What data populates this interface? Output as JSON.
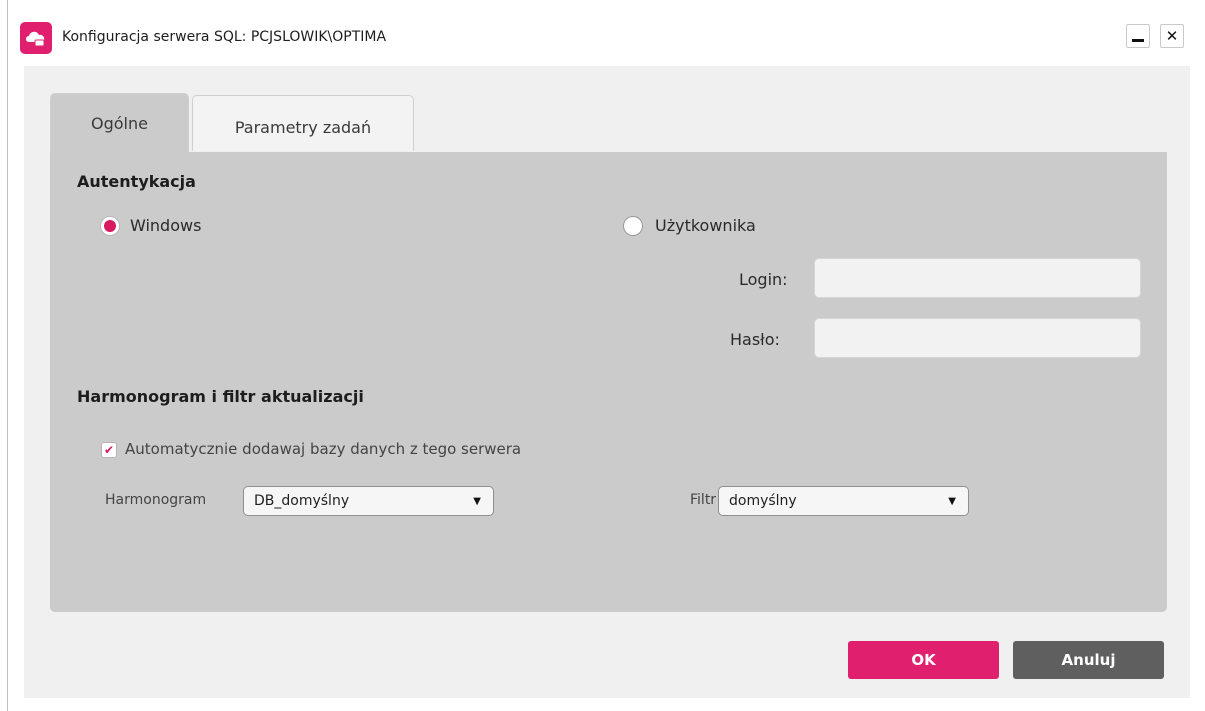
{
  "window": {
    "title": "Konfiguracja serwera SQL: PCJSLOWIK\\OPTIMA"
  },
  "tabs": [
    {
      "label": "Ogólne",
      "active": true
    },
    {
      "label": "Parametry zadań",
      "active": false
    }
  ],
  "auth": {
    "section_title": "Autentykacja",
    "windows_label": "Windows",
    "user_label": "Użytkownika",
    "selected": "Windows",
    "login_label": "Login:",
    "login_value": "",
    "password_label": "Hasło:",
    "password_value": ""
  },
  "schedule": {
    "section_title": "Harmonogram i filtr aktualizacji",
    "auto_add_label": "Automatycznie dodawaj bazy danych z tego serwera",
    "auto_add_checked": true,
    "harmonogram_label": "Harmonogram",
    "harmonogram_value": "DB_domyślny",
    "filter_label": "Filtr",
    "filter_value": "domyślny"
  },
  "buttons": {
    "ok": "OK",
    "cancel": "Anuluj"
  },
  "colors": {
    "accent": "#e0206f",
    "panel": "#cbcbcb",
    "cancel_button": "#5f5f5f"
  }
}
